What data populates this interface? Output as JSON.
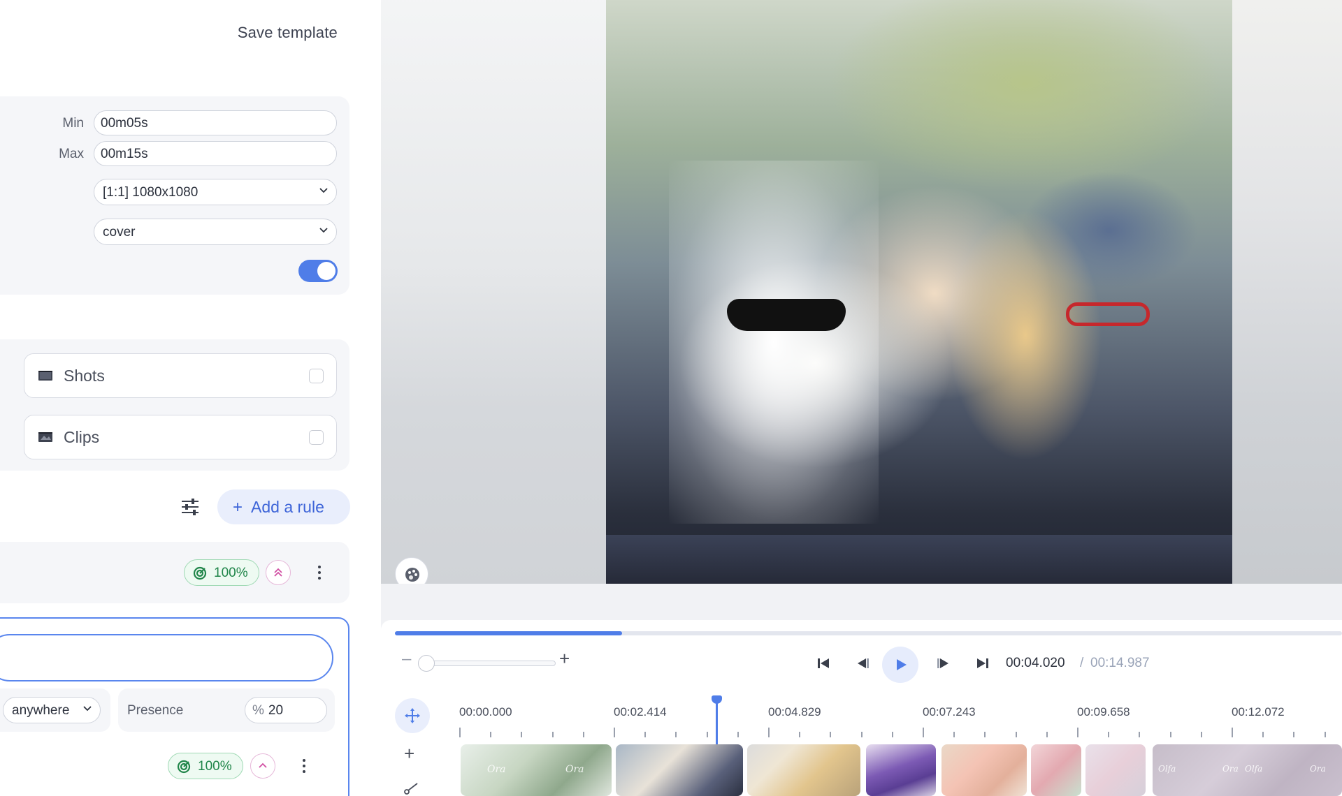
{
  "header": {
    "save_template": "Save template"
  },
  "duration": {
    "min_label": "Min",
    "min_value": "00m05s",
    "max_label": "Max",
    "max_value": "00m15s"
  },
  "format": {
    "selected": "[1:1] 1080x1080"
  },
  "fit": {
    "selected": "cover"
  },
  "toggle": {
    "on": true
  },
  "sources": [
    {
      "label": "Shots",
      "checked": false
    },
    {
      "label": "Clips",
      "checked": false
    }
  ],
  "rules": {
    "add_label": "Add a rule",
    "rule1": {
      "badge": "100%"
    },
    "rule2": {
      "position": "anywhere",
      "presence_label": "Presence",
      "presence_unit": "%",
      "presence_value": "20",
      "badge": "100%"
    }
  },
  "player": {
    "progress": 0.24,
    "current_time": "00:04.020",
    "separator": "/",
    "total_time": "00:14.987"
  },
  "timeline": {
    "ticks": [
      "00:00.000",
      "00:02.414",
      "00:04.829",
      "00:07.243",
      "00:09.658",
      "00:12.072"
    ],
    "thumb_labels": [
      "Ora",
      "Ora",
      "Olfa",
      "Ora",
      "Olfa",
      "Ora"
    ]
  },
  "colors": {
    "accent": "#4f7de8",
    "success": "#21864a",
    "pink": "#d14fa3"
  }
}
